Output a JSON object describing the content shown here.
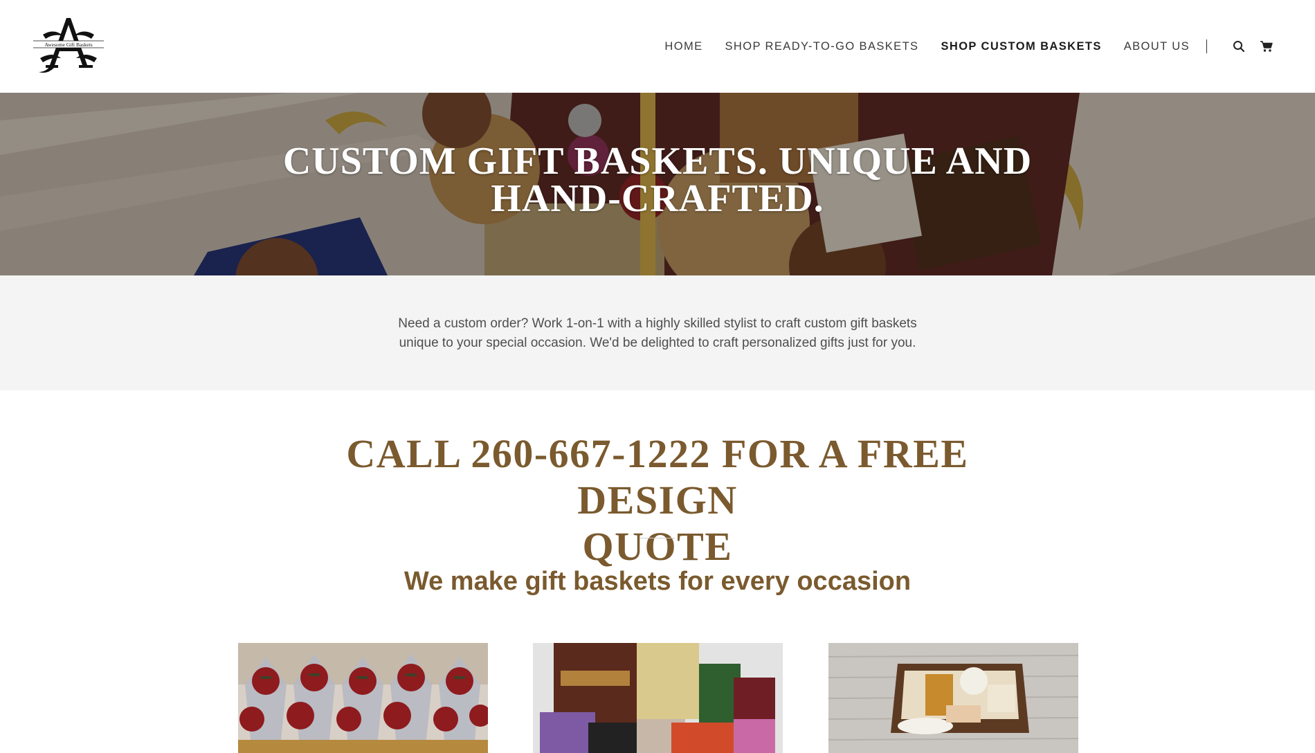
{
  "brand": {
    "logo_text": "Awesome Gift Baskets",
    "logo_letter": "A"
  },
  "nav": {
    "items": [
      {
        "label": "HOME",
        "active": false
      },
      {
        "label": "SHOP READY-TO-GO BASKETS",
        "active": false
      },
      {
        "label": "SHOP CUSTOM BASKETS",
        "active": true
      },
      {
        "label": "ABOUT US",
        "active": false
      }
    ],
    "search_icon": "search-icon",
    "cart_icon": "cart-icon"
  },
  "hero": {
    "title_line1": "CUSTOM GIFT BASKETS. UNIQUE AND",
    "title_line2": "HAND-CRAFTED."
  },
  "intro": {
    "line1": "Need a custom order? Work 1-on-1 with a highly skilled stylist to craft custom gift baskets",
    "line2": "unique to your special occasion. We'd be delighted to craft personalized gifts just for you."
  },
  "cta": {
    "line1": "CALL 260-667-1222 FOR A FREE DESIGN",
    "line2": "QUOTE"
  },
  "subtitle": "We make gift baskets for every occasion",
  "gallery": [
    {
      "name": "plaid-bow-baskets-photo"
    },
    {
      "name": "tea-and-snacks-photo"
    },
    {
      "name": "spa-basket-photo"
    }
  ],
  "colors": {
    "accent_brown": "#7a5a2e",
    "intro_bg": "#f4f4f4",
    "nav_text": "#3a3a3a"
  }
}
